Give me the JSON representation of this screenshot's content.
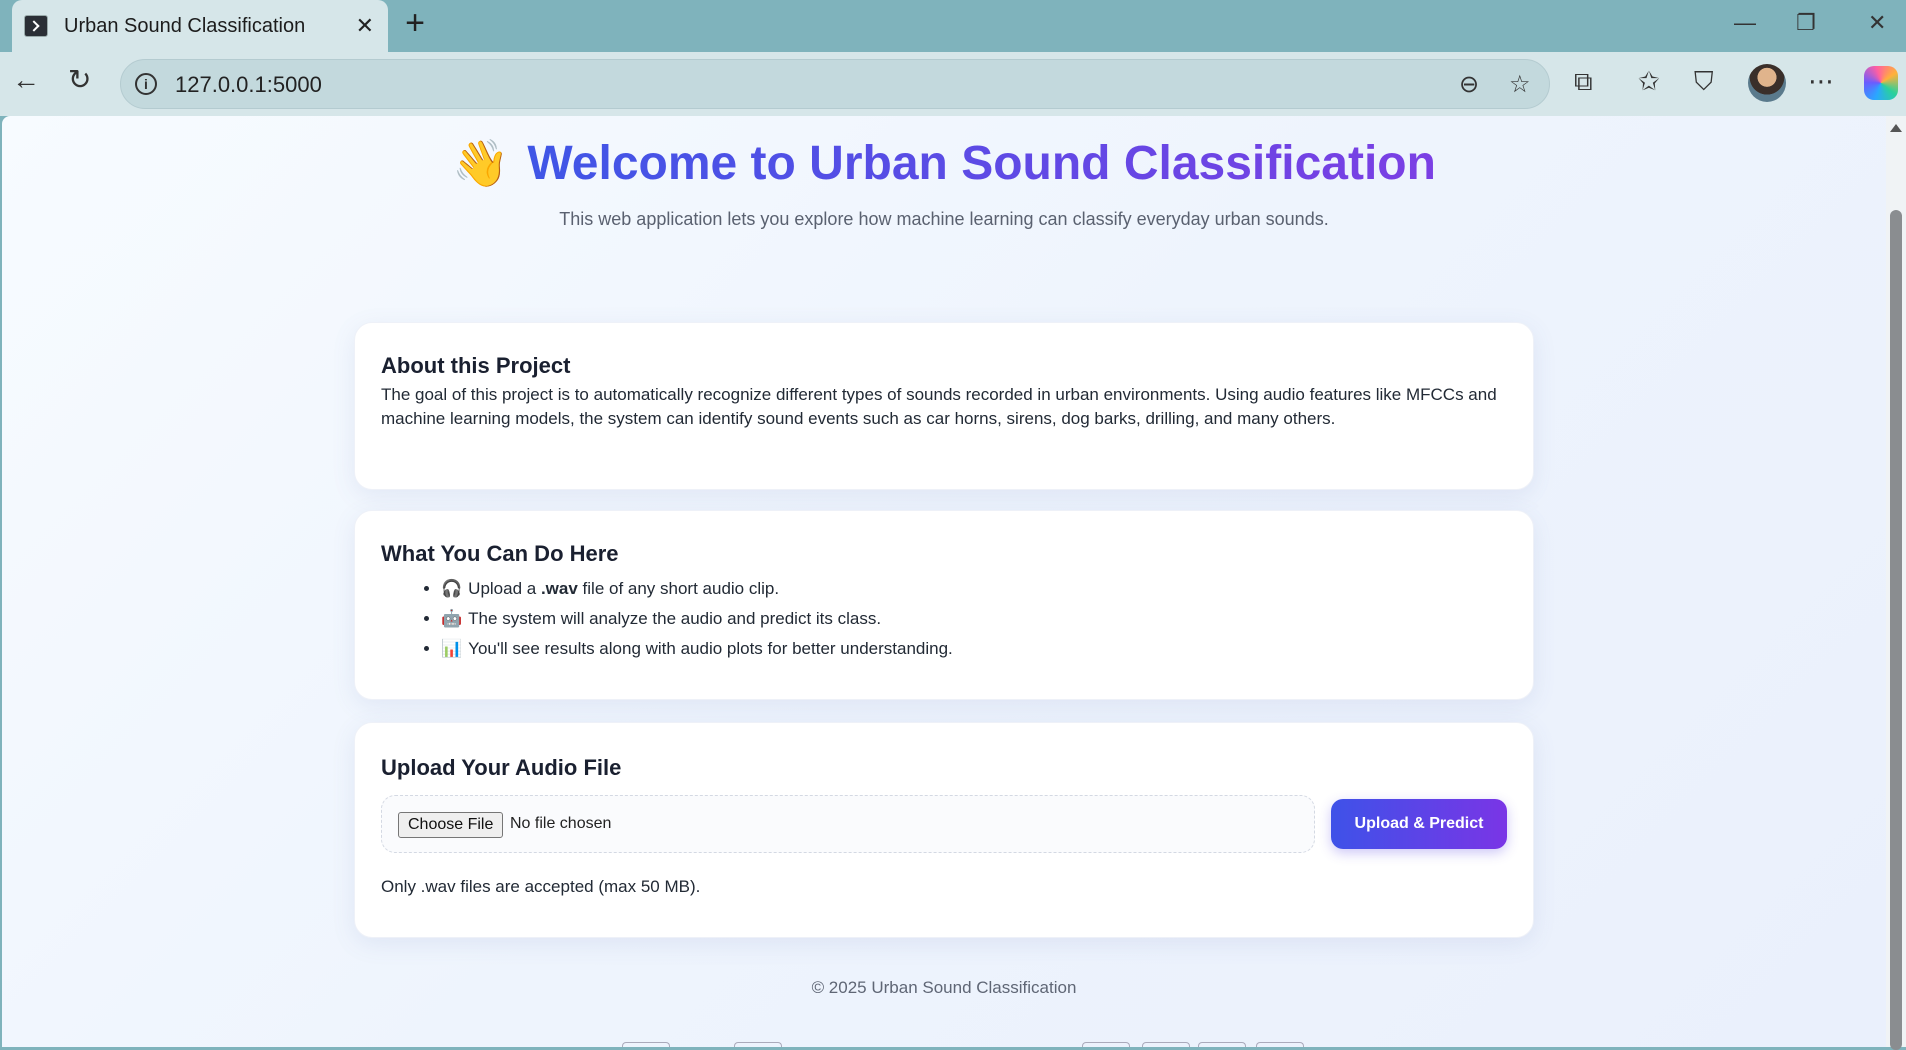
{
  "browser": {
    "tab_title": "Urban Sound Classification",
    "tab_close": "✕",
    "new_tab": "+",
    "url": "127.0.0.1:5000"
  },
  "hero": {
    "icon": "👋",
    "title": "Welcome to Urban Sound Classification",
    "subtitle": "This web application lets you explore how machine learning can classify everyday urban sounds."
  },
  "about": {
    "heading": "About this Project",
    "text": "The goal of this project is to automatically recognize different types of sounds recorded in urban environments. Using audio features like MFCCs and machine learning models, the system can identify sound events such as car horns, sirens, dog barks, drilling, and many others."
  },
  "what_you_can_do": {
    "heading": "What You Can Do Here",
    "items": [
      {
        "emoji": "🎧",
        "pre": "Upload a ",
        "bold": ".wav",
        "post": " file of any short audio clip."
      },
      {
        "emoji": "🤖",
        "pre": "The system will analyze the audio and predict its class.",
        "bold": "",
        "post": ""
      },
      {
        "emoji": "📊",
        "pre": "You'll see results along with audio plots for better understanding.",
        "bold": "",
        "post": ""
      }
    ]
  },
  "upload": {
    "heading": "Upload Your Audio File",
    "choose_label": "Choose File",
    "file_status": "No file chosen",
    "submit_label": "Upload & Predict",
    "note": "Only .wav files are accepted (max 50 MB)."
  },
  "footer": {
    "text": "© 2025 Urban Sound Classification"
  },
  "colors": {
    "accent_start": "#3f56e6",
    "accent_end": "#7b3fe4"
  }
}
